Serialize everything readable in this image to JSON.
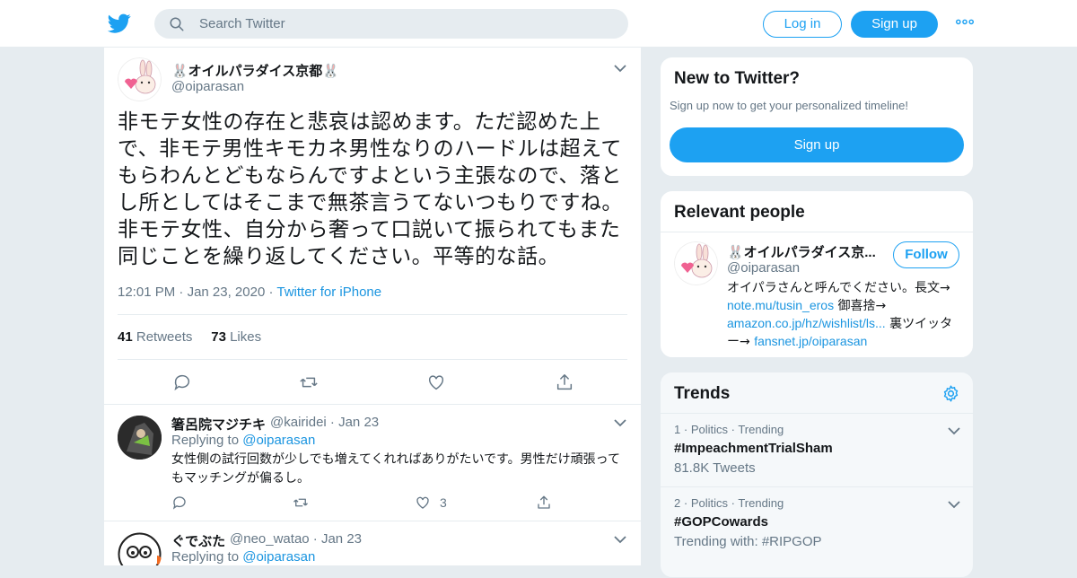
{
  "header": {
    "search_placeholder": "Search Twitter",
    "login_label": "Log in",
    "signup_label": "Sign up",
    "more_label": "•••"
  },
  "tweet": {
    "author_name": "🐰オイルパラダイス京都🐰",
    "author_handle": "@oiparasan",
    "text": "非モテ女性の存在と悲哀は認めます。ただ認めた上で、非モテ男性キモカネ男性なりのハードルは超えてもらわんとどもならんですよという主張なので、落とし所としてはそこまで無茶言うてないつもりですね。非モテ女性、自分から奢って口説いて振られてもまた同じことを繰り返してください。平等的な話。",
    "time": "12:01 PM",
    "date": "Jan 23, 2020",
    "source": "Twitter for iPhone",
    "retweets_count": "41",
    "retweets_label": "Retweets",
    "likes_count": "73",
    "likes_label": "Likes"
  },
  "replies": [
    {
      "name": "箸呂院マジチキ",
      "handle": "@kairidei",
      "date": "Jan 23",
      "replying_label": "Replying to",
      "replying_to": "@oiparasan",
      "text": "女性側の試行回数が少しでも増えてくれればありがたいです。男性だけ頑張ってもマッチングが偏るし。",
      "likes": "3"
    },
    {
      "name": "ぐでぶた",
      "handle": "@neo_watao",
      "date": "Jan 23",
      "replying_label": "Replying to",
      "replying_to": "@oiparasan"
    }
  ],
  "new_to_twitter": {
    "title": "New to Twitter?",
    "subtitle": "Sign up now to get your personalized timeline!",
    "signup_label": "Sign up"
  },
  "relevant_people": {
    "title": "Relevant people",
    "name": "🐰オイルパラダイス京...",
    "handle": "@oiparasan",
    "follow_label": "Follow",
    "bio_1": "オイパラさんと呼んでください。長文→ ",
    "bio_link_1": "note.mu/tusin_eros",
    "bio_2": " 御喜捨→ ",
    "bio_link_2": "amazon.co.jp/hz/wishlist/ls...",
    "bio_3": " 裏ツイッター→ ",
    "bio_link_3": "fansnet.jp/oiparasan"
  },
  "trends": {
    "title": "Trends",
    "items": [
      {
        "rank": "1",
        "category": "Politics",
        "status": "Trending",
        "name": "#ImpeachmentTrialSham",
        "sub": "81.8K Tweets"
      },
      {
        "rank": "2",
        "category": "Politics",
        "status": "Trending",
        "name": "#GOPCowards",
        "sub": "Trending with: #RIPGOP"
      }
    ]
  },
  "colors": {
    "accent": "#1da1f2",
    "link": "#1b95e0",
    "muted": "#657786",
    "background": "#e6ecf0"
  }
}
